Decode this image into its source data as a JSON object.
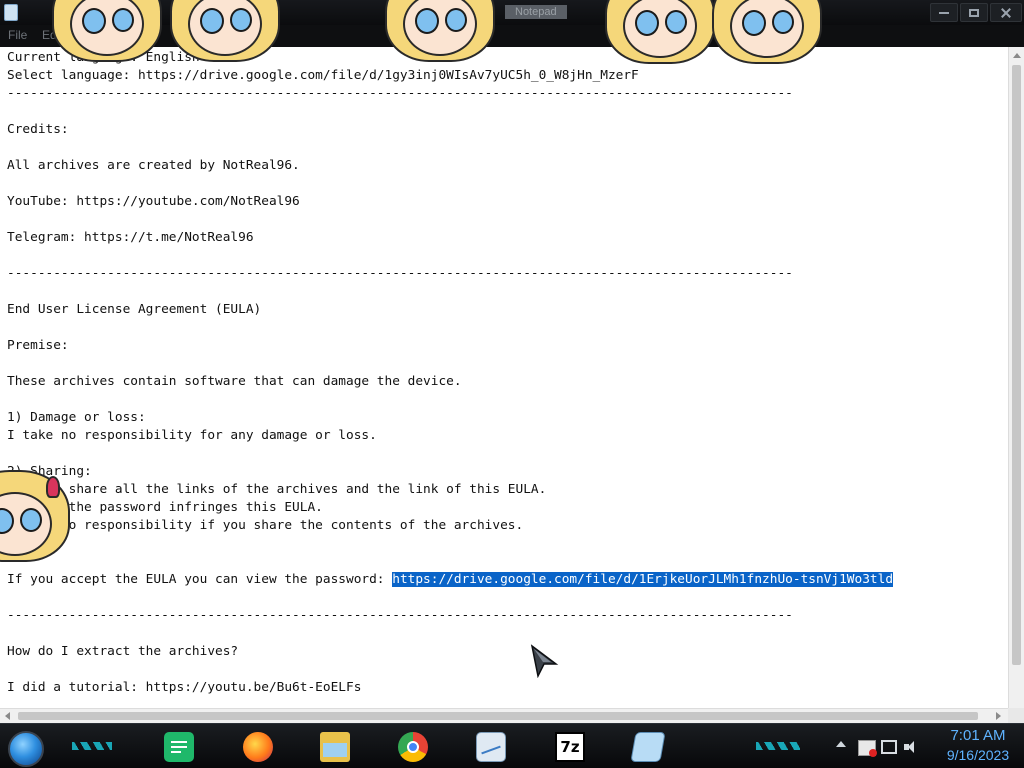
{
  "window": {
    "title": "Notepad"
  },
  "menu": {
    "items": [
      "File",
      "Edit"
    ]
  },
  "editor": {
    "lines": [
      "Current language: English",
      "Select language: https://drive.google.com/file/d/1gy3inj0WIsAv7yUC5h_0_W8jHn_MzerF",
      "------------------------------------------------------------------------------------------------------",
      "",
      "Credits:",
      "",
      "All archives are created by NotReal96.",
      "",
      "YouTube: https://youtube.com/NotReal96",
      "",
      "Telegram: https://t.me/NotReal96",
      "",
      "------------------------------------------------------------------------------------------------------",
      "",
      "End User License Agreement (EULA)",
      "",
      "Premise:",
      "",
      "These archives contain software that can damage the device.",
      "",
      "1) Damage or loss:",
      "I take no responsibility for any damage or loss.",
      "",
      "2) Sharing:",
      "You can share all the links of the archives and the link of this EULA.",
      "Sharing the password infringes this EULA.",
      "I take no responsibility if you share the contents of the archives.",
      "",
      "",
      "If you accept the EULA you can view the password: ",
      "",
      "------------------------------------------------------------------------------------------------------",
      "",
      "How do I extract the archives?",
      "",
      "I did a tutorial: https://youtu.be/Bu6t-EoELFs"
    ],
    "selected_link": "https://drive.google.com/file/d/1ErjkeUorJLMh1fnzhUo-tsnVj1Wo3tld",
    "selected_line_index": 29
  },
  "taskbar": {
    "apps": [
      {
        "name": "google-docs-icon",
        "color": "#1fb86a"
      },
      {
        "name": "firefox-icon",
        "color": "#ff7a1a"
      },
      {
        "name": "file-explorer-icon",
        "color": "#e8c14a"
      },
      {
        "name": "chrome-icon",
        "color": "#e84335"
      },
      {
        "name": "task-manager-icon",
        "color": "#9fc5e8"
      },
      {
        "name": "7zip-icon",
        "color": "#ffffff"
      },
      {
        "name": "notepad-icon",
        "color": "#b8dcf5"
      }
    ],
    "clock": {
      "time": "7:01 AM",
      "date": "9/16/2023"
    }
  },
  "colors": {
    "selection": "#0a64c8",
    "clock": "#5fb3ff",
    "taskbar_accent": "#1ab6c8"
  }
}
